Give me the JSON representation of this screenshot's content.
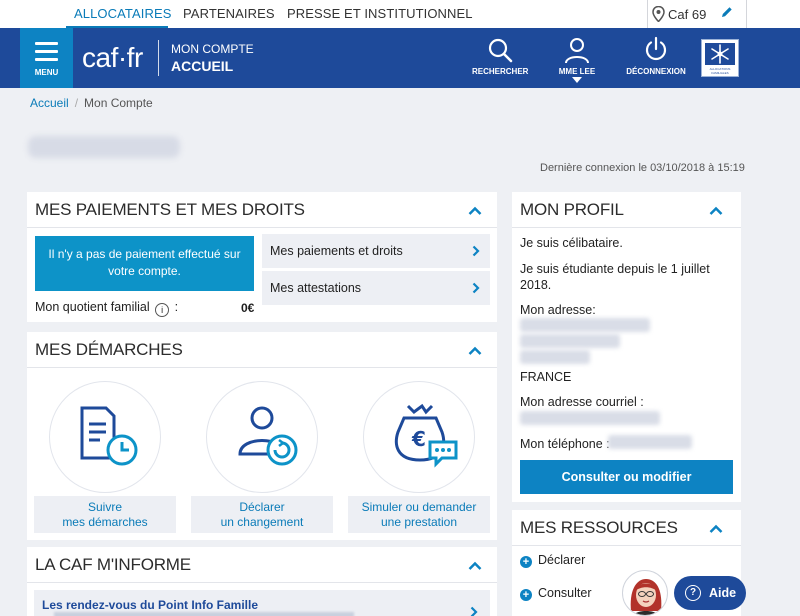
{
  "topnav": {
    "tabs": [
      "ALLOCATAIRES",
      "PARTENAIRES",
      "PRESSE ET INSTITUTIONNEL"
    ],
    "caf_label": "Caf 69"
  },
  "header": {
    "menu_label": "MENU",
    "logo": "caf·fr",
    "account_line1": "MON COMPTE",
    "account_line2": "ACCUEIL",
    "search_label": "RECHERCHER",
    "user_label": "MME LEE",
    "logout_label": "DÉCONNEXION",
    "brand_small": "ALLOCATIONS FAMILIALES"
  },
  "breadcrumb": {
    "home": "Accueil",
    "separator": "/",
    "current": "Mon Compte"
  },
  "last_login": "Dernière connexion le 03/10/2018 à 15:19",
  "payments": {
    "title": "MES PAIEMENTS ET MES DROITS",
    "no_payment": "Il n'y a pas de paiement effectué sur votre compte.",
    "links": [
      "Mes paiements et droits",
      "Mes attestations"
    ],
    "quotient_label": "Mon quotient familial",
    "quotient_colon": ":",
    "quotient_value": "0€"
  },
  "demarches": {
    "title": "MES DÉMARCHES",
    "actions": [
      {
        "line1": "Suivre",
        "line2": "mes démarches"
      },
      {
        "line1": "Déclarer",
        "line2": "un changement"
      },
      {
        "line1": "Simuler ou demander",
        "line2": "une prestation"
      }
    ]
  },
  "informe": {
    "title": "LA CAF M'INFORME",
    "link": "Les rendez-vous du Point Info Famille"
  },
  "profile": {
    "title": "MON PROFIL",
    "status": "Je suis célibataire.",
    "student": "Je suis étudiante depuis le 1 juillet 2018.",
    "address_label": "Mon adresse:",
    "country": "FRANCE",
    "email_label": "Mon adresse courriel :",
    "phone_label": "Mon téléphone :",
    "button": "Consulter ou modifier"
  },
  "resources": {
    "title": "MES RESSOURCES",
    "items": [
      "Déclarer",
      "Consulter"
    ]
  },
  "help": {
    "label": "Aide"
  },
  "colors": {
    "brand_blue": "#1e4a9a",
    "accent_blue": "#0d83c3",
    "link_blue": "#0a7bb8"
  }
}
